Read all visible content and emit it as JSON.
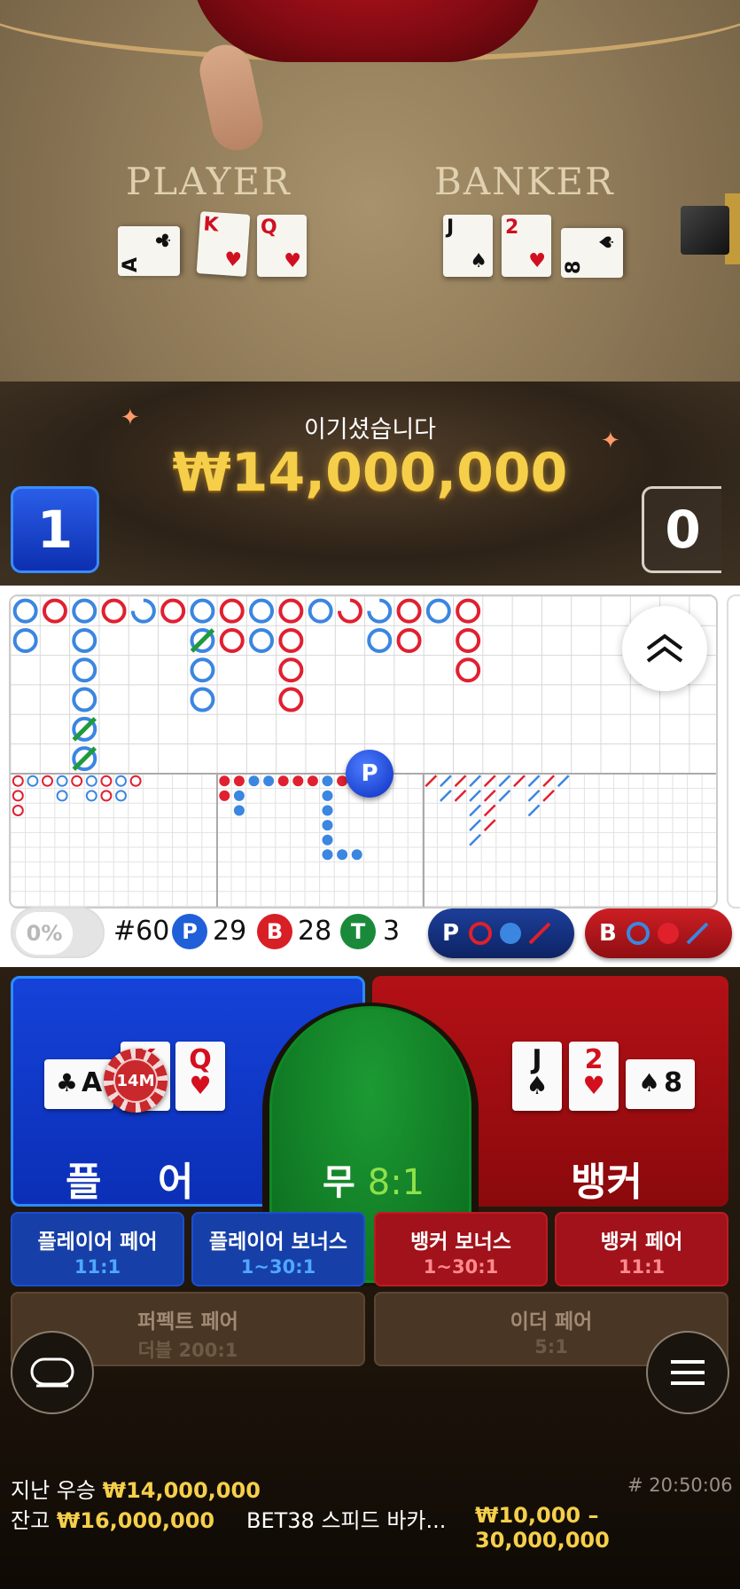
{
  "table": {
    "player_label": "PLAYER",
    "banker_label": "BANKER",
    "player_cards": [
      {
        "rank": "A",
        "suit": "♣",
        "color": "black"
      },
      {
        "rank": "K",
        "suit": "♥",
        "color": "red"
      },
      {
        "rank": "Q",
        "suit": "♥",
        "color": "red"
      }
    ],
    "banker_cards": [
      {
        "rank": "J",
        "suit": "♠",
        "color": "black"
      },
      {
        "rank": "2",
        "suit": "♥",
        "color": "red"
      },
      {
        "rank": "8",
        "suit": "♠",
        "color": "black"
      }
    ]
  },
  "result": {
    "title": "이기셨습니다",
    "amount": "₩14,000,000",
    "player_score": "1",
    "banker_score": "0"
  },
  "roads": {
    "marker": "P",
    "big_road_columns": [
      [
        {
          "c": "b"
        },
        {
          "c": "b"
        }
      ],
      [
        {
          "c": "r"
        }
      ],
      [
        {
          "c": "b"
        },
        {
          "c": "b"
        },
        {
          "c": "b"
        },
        {
          "c": "b"
        },
        {
          "c": "b",
          "tie": true
        },
        {
          "c": "b",
          "tie": true
        }
      ],
      [
        {
          "c": "r"
        }
      ],
      [
        {
          "c": "b",
          "partial": true
        }
      ],
      [
        {
          "c": "r"
        }
      ],
      [
        {
          "c": "b"
        },
        {
          "c": "b",
          "tie": true
        },
        {
          "c": "b"
        },
        {
          "c": "b"
        }
      ],
      [
        {
          "c": "r"
        },
        {
          "c": "r"
        }
      ],
      [
        {
          "c": "b"
        },
        {
          "c": "b"
        }
      ],
      [
        {
          "c": "r"
        },
        {
          "c": "r"
        },
        {
          "c": "r"
        },
        {
          "c": "r"
        }
      ],
      [
        {
          "c": "b"
        }
      ],
      [
        {
          "c": "r",
          "partial": true
        }
      ],
      [
        {
          "c": "b",
          "partial": true
        },
        {
          "c": "b"
        }
      ],
      [
        {
          "c": "r"
        },
        {
          "c": "r"
        }
      ],
      [
        {
          "c": "b"
        }
      ],
      [
        {
          "c": "r"
        },
        {
          "c": "r"
        },
        {
          "c": "r"
        }
      ]
    ]
  },
  "stats": {
    "percent": "0%",
    "round": "#60",
    "player_letter": "P",
    "player_count": "29",
    "banker_letter": "B",
    "banker_count": "28",
    "tie_letter": "T",
    "tie_count": "3",
    "ask_player": "P",
    "ask_banker": "B"
  },
  "bets": {
    "player_label_left": "플",
    "player_label_right": "어",
    "tie_label": "무",
    "tie_odds": "8:1",
    "banker_label": "뱅커",
    "chip": "14M",
    "player_cards": [
      {
        "rank": "A",
        "suit": "♣",
        "color": "black"
      },
      {
        "rank": "K",
        "suit": "♥",
        "color": "red"
      },
      {
        "rank": "Q",
        "suit": "♥",
        "color": "red"
      }
    ],
    "banker_cards": [
      {
        "rank": "J",
        "suit": "♠",
        "color": "black"
      },
      {
        "rank": "2",
        "suit": "♥",
        "color": "red"
      },
      {
        "rank": "8",
        "suit": "♠",
        "color": "black"
      }
    ],
    "side_bets": [
      {
        "name": "플레이어 페어",
        "odds": "11:1"
      },
      {
        "name": "플레이어 보너스",
        "odds": "1~30:1"
      },
      {
        "name": "뱅커 보너스",
        "odds": "1~30:1"
      },
      {
        "name": "뱅커 페어",
        "odds": "11:1"
      },
      {
        "name": "퍼펙트 페어",
        "odds": "더블 200:1"
      },
      {
        "name": "이더 페어",
        "odds": "5:1"
      }
    ]
  },
  "footer": {
    "last_win_label": "지난 우승",
    "last_win_amount": "₩14,000,000",
    "game_id": "# 20:50:06",
    "balance_label": "잔고",
    "balance_amount": "₩16,000,000",
    "table_name": "BET38 스피드 바카...",
    "limits": "₩10,000 – 30,000,000"
  },
  "colors": {
    "player_blue": "#1542d8",
    "banker_red": "#b31116",
    "tie_green": "#1c9a33",
    "gold": "#f6cf4a",
    "road_blue": "#3b86e0",
    "road_red": "#e02030",
    "tie_slash": "#1f9a3c"
  }
}
